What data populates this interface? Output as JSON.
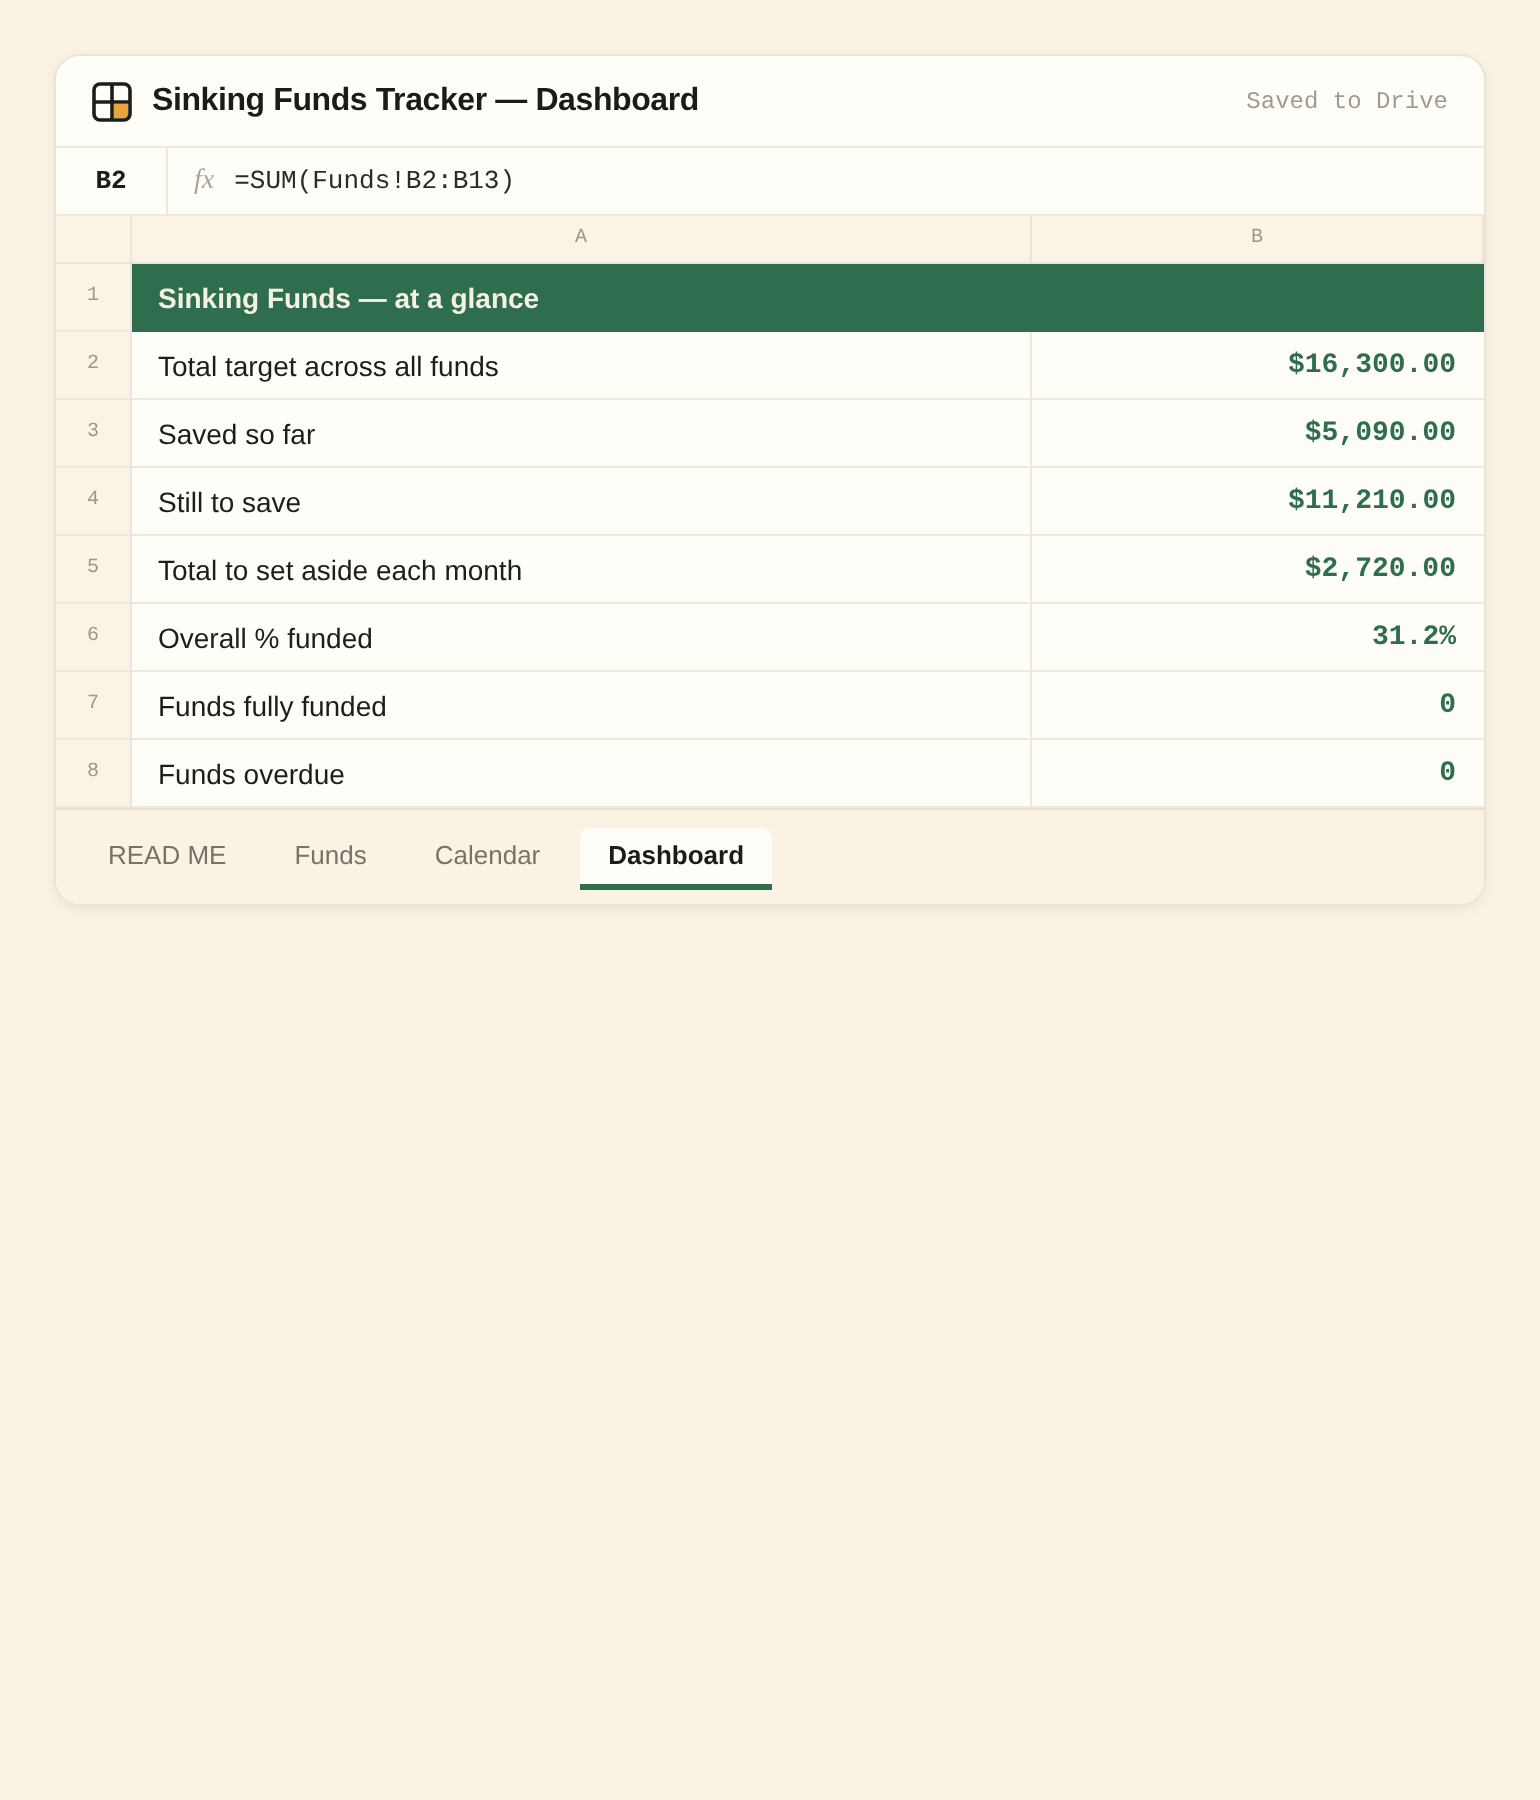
{
  "window": {
    "title": "Sinking Funds Tracker — Dashboard",
    "status": "Saved to Drive"
  },
  "formula_bar": {
    "cell": "B2",
    "fx": "fx",
    "formula": "=SUM(Funds!B2:B13)"
  },
  "columns": [
    "A",
    "B"
  ],
  "rows": [
    {
      "number": "1",
      "kind": "header",
      "label": "Sinking Funds — at a glance"
    },
    {
      "number": "2",
      "kind": "value",
      "label": "Total target across all funds",
      "value": "$16,300.00"
    },
    {
      "number": "3",
      "kind": "value",
      "label": "Saved so far",
      "value": "$5,090.00"
    },
    {
      "number": "4",
      "kind": "value",
      "label": "Still to save",
      "value": "$11,210.00"
    },
    {
      "number": "5",
      "kind": "value",
      "label": "Total to set aside each month",
      "value": "$2,720.00"
    },
    {
      "number": "6",
      "kind": "value",
      "label": "Overall % funded",
      "value": "31.2%"
    },
    {
      "number": "7",
      "kind": "value",
      "label": "Funds fully funded",
      "value": "0"
    },
    {
      "number": "8",
      "kind": "value",
      "label": "Funds overdue",
      "value": "0"
    }
  ],
  "sheet_tabs": [
    {
      "label": "READ ME",
      "selected": false
    },
    {
      "label": "Funds",
      "selected": false
    },
    {
      "label": "Calendar",
      "selected": false
    },
    {
      "label": "Dashboard",
      "selected": true
    }
  ]
}
